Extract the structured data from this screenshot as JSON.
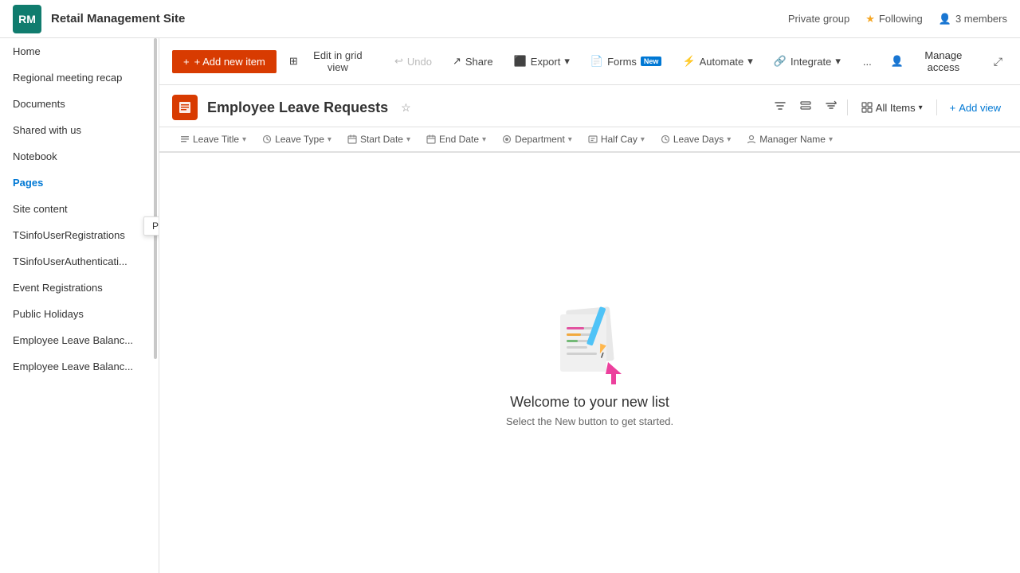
{
  "topbar": {
    "logo_initials": "RM",
    "site_title": "Retail Management Site",
    "private_group_label": "Private group",
    "following_label": "Following",
    "members_label": "3 members"
  },
  "sidebar": {
    "items": [
      {
        "id": "home",
        "label": "Home",
        "active": false
      },
      {
        "id": "regional-meeting-recap",
        "label": "Regional meeting recap",
        "active": false
      },
      {
        "id": "documents",
        "label": "Documents",
        "active": false
      },
      {
        "id": "shared-with-us",
        "label": "Shared with us",
        "active": false
      },
      {
        "id": "notebook",
        "label": "Notebook",
        "active": false
      },
      {
        "id": "pages",
        "label": "Pages",
        "active": true
      },
      {
        "id": "site-content",
        "label": "Site content",
        "active": false
      },
      {
        "id": "tsinfouser-registrations",
        "label": "TSinfoUserRegistrations",
        "active": false
      },
      {
        "id": "tsinfouser-authentication",
        "label": "TSinfoUserAuthenticati...",
        "active": false
      },
      {
        "id": "event-registrations",
        "label": "Event Registrations",
        "active": false
      },
      {
        "id": "public-holidays",
        "label": "Public Holidays",
        "active": false
      },
      {
        "id": "employee-leave-balance1",
        "label": "Employee Leave Balanc...",
        "active": false
      },
      {
        "id": "employee-leave-balance2",
        "label": "Employee Leave Balanc...",
        "active": false
      }
    ],
    "tooltip": "Pages"
  },
  "toolbar": {
    "add_new_label": "+ Add new item",
    "edit_grid_label": "Edit in grid view",
    "undo_label": "Undo",
    "share_label": "Share",
    "export_label": "Export",
    "forms_label": "Forms",
    "forms_badge": "New",
    "automate_label": "Automate",
    "integrate_label": "Integrate",
    "more_label": "...",
    "manage_access_label": "Manage access"
  },
  "list_header": {
    "icon": "📋",
    "title": "Employee Leave Requests",
    "view_label": "All Items"
  },
  "columns": [
    {
      "id": "leave-title",
      "label": "Leave Title"
    },
    {
      "id": "leave-type",
      "label": "Leave Type"
    },
    {
      "id": "start-date",
      "label": "Start Date"
    },
    {
      "id": "end-date",
      "label": "End Date"
    },
    {
      "id": "department",
      "label": "Department"
    },
    {
      "id": "half-day",
      "label": "Half Cay"
    },
    {
      "id": "leave-days",
      "label": "Leave Days"
    },
    {
      "id": "manager-name",
      "label": "Manager Name"
    }
  ],
  "empty_state": {
    "title": "Welcome to your new list",
    "subtitle": "Select the New button to get started."
  }
}
